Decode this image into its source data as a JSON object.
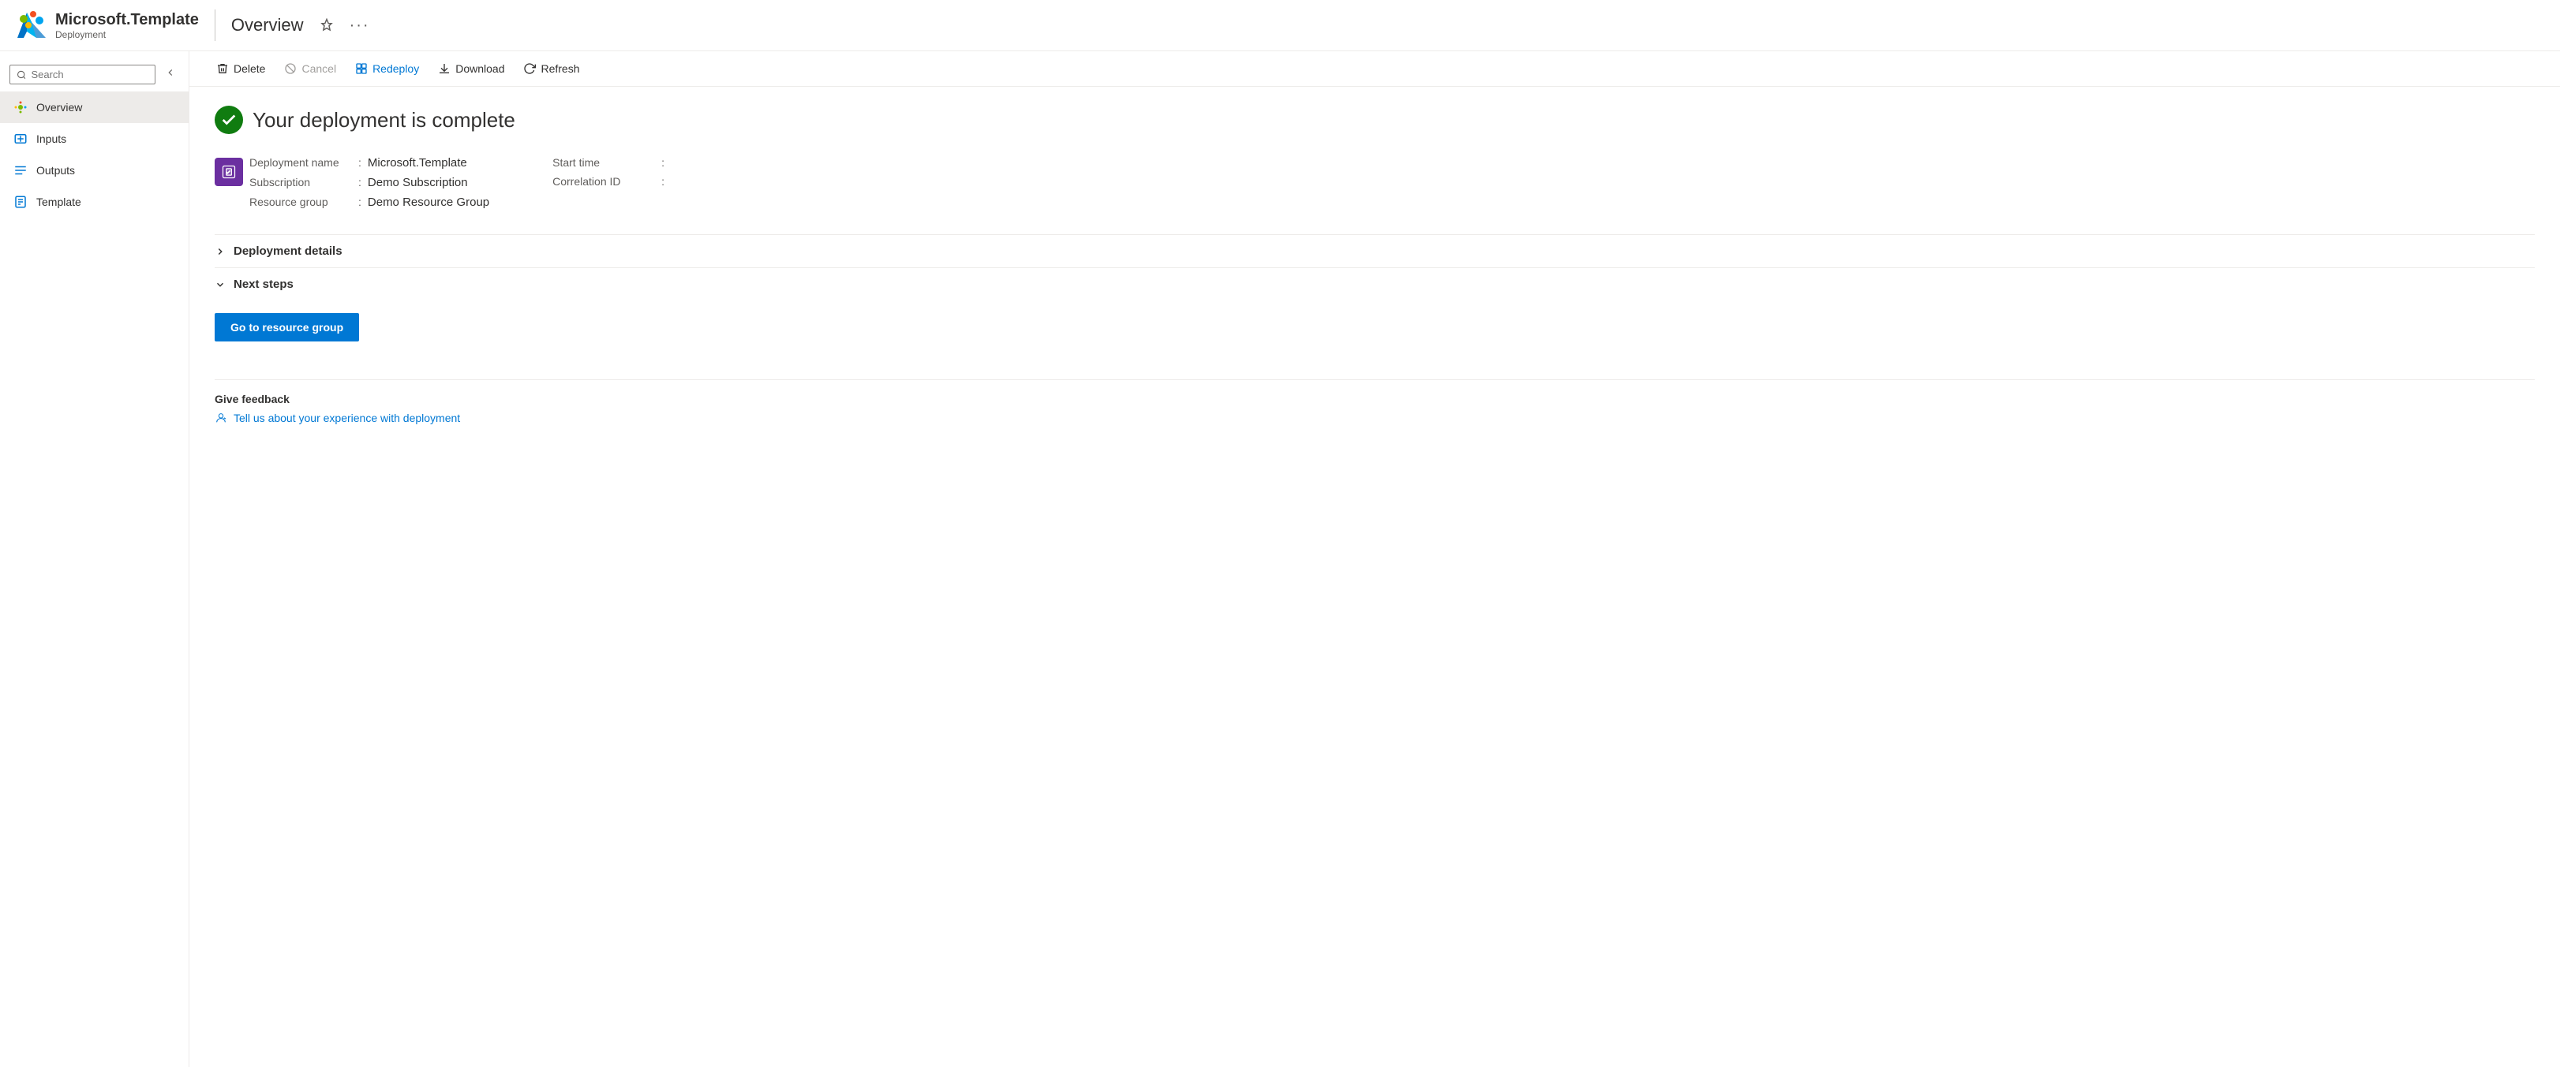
{
  "header": {
    "title": "Microsoft.Template",
    "subtitle": "Deployment",
    "page_title": "Overview",
    "pin_icon": "📌",
    "more_icon": "···"
  },
  "sidebar": {
    "search_placeholder": "Search",
    "nav_items": [
      {
        "id": "overview",
        "label": "Overview",
        "active": true
      },
      {
        "id": "inputs",
        "label": "Inputs",
        "active": false
      },
      {
        "id": "outputs",
        "label": "Outputs",
        "active": false
      },
      {
        "id": "template",
        "label": "Template",
        "active": false
      }
    ]
  },
  "toolbar": {
    "delete_label": "Delete",
    "cancel_label": "Cancel",
    "redeploy_label": "Redeploy",
    "download_label": "Download",
    "refresh_label": "Refresh"
  },
  "content": {
    "status_message": "Your deployment is complete",
    "deployment_name_label": "Deployment name",
    "deployment_name_value": "Microsoft.Template",
    "subscription_label": "Subscription",
    "subscription_value": "Demo Subscription",
    "resource_group_label": "Resource group",
    "resource_group_value": "Demo Resource Group",
    "start_time_label": "Start time",
    "start_time_value": "",
    "correlation_id_label": "Correlation ID",
    "correlation_id_value": "",
    "deployment_details_label": "Deployment details",
    "next_steps_label": "Next steps",
    "go_to_resource_group_label": "Go to resource group",
    "feedback_title": "Give feedback",
    "feedback_link": "Tell us about your experience with deployment"
  },
  "colors": {
    "accent_blue": "#0078d4",
    "success_green": "#107c10",
    "purple_icon": "#6b2fa0"
  }
}
